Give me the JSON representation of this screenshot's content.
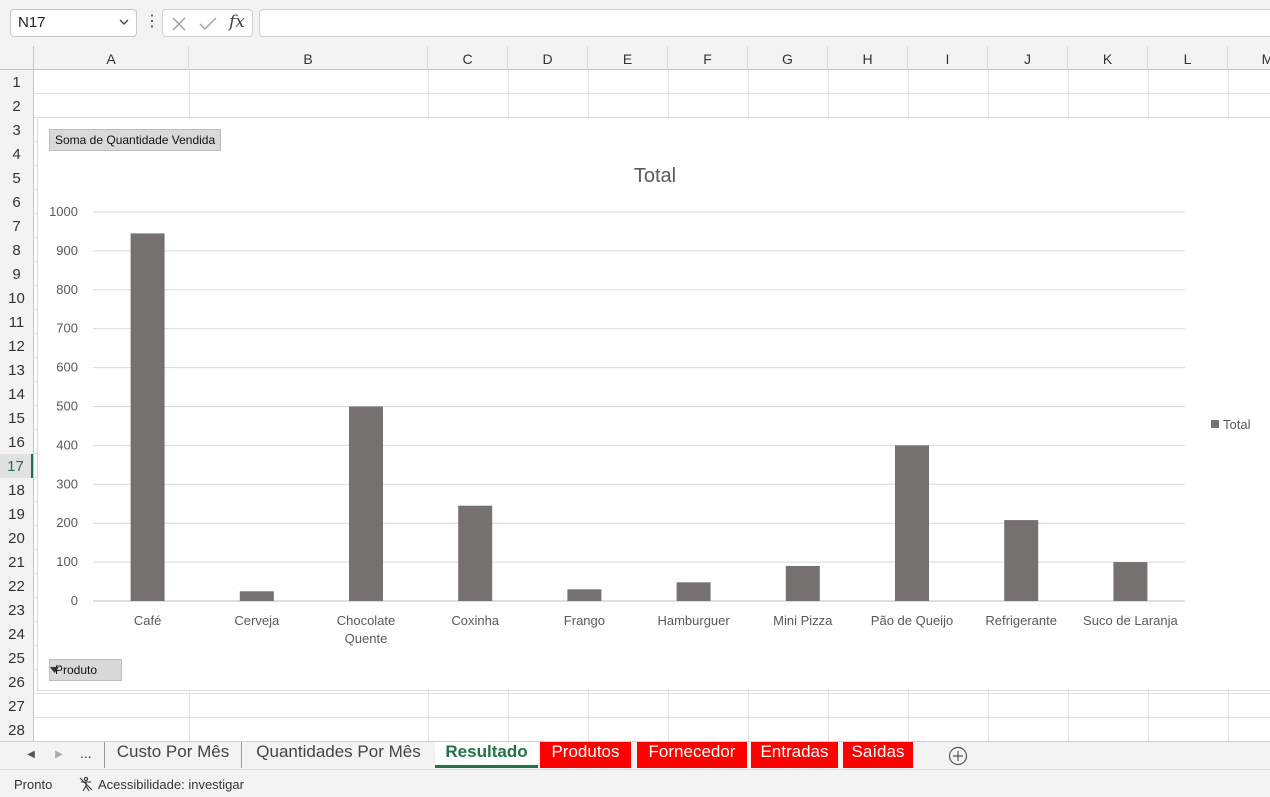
{
  "formula_bar": {
    "name_box": "N17",
    "fx_label": "fx",
    "formula_value": ""
  },
  "columns": [
    "A",
    "B",
    "C",
    "D",
    "E",
    "F",
    "G",
    "H",
    "I",
    "J",
    "K",
    "L",
    "M"
  ],
  "rows": [
    "1",
    "2",
    "3",
    "4",
    "5",
    "6",
    "7",
    "8",
    "9",
    "10",
    "11",
    "12",
    "13",
    "14",
    "15",
    "16",
    "17",
    "18",
    "19",
    "20",
    "21",
    "22",
    "23",
    "24",
    "25",
    "26",
    "27",
    "28"
  ],
  "active_row": "17",
  "pivot_buttons": {
    "values_field": "Soma de Quantidade Vendida",
    "axis_field": "Produto"
  },
  "chart_data": {
    "type": "bar",
    "title": "Total",
    "categories": [
      "Café",
      "Cerveja",
      "Chocolate Quente",
      "Coxinha",
      "Frango",
      "Hamburguer",
      "Mini Pizza",
      "Pão de Queijo",
      "Refrigerante",
      "Suco de Laranja"
    ],
    "category_lines": [
      [
        "Café"
      ],
      [
        "Cerveja"
      ],
      [
        "Chocolate",
        "Quente"
      ],
      [
        "Coxinha"
      ],
      [
        "Frango"
      ],
      [
        "Hamburguer"
      ],
      [
        "Mini Pizza"
      ],
      [
        "Pão de Queijo"
      ],
      [
        "Refrigerante"
      ],
      [
        "Suco de Laranja"
      ]
    ],
    "series": [
      {
        "name": "Total",
        "values": [
          945,
          25,
          500,
          245,
          30,
          48,
          90,
          400,
          208,
          100
        ]
      }
    ],
    "yticks": [
      0,
      100,
      200,
      300,
      400,
      500,
      600,
      700,
      800,
      900,
      1000
    ],
    "ylim": [
      0,
      1000
    ],
    "grid": true,
    "legend": "right",
    "bar_color": "#767171"
  },
  "legend_label": "Total",
  "sheet_tabs": {
    "ellipsis": "...",
    "tabs": [
      "Custo Por Mês",
      "Quantidades Por Mês",
      "Resultado",
      "Produtos",
      "Fornecedor",
      "Entradas",
      "Saídas"
    ],
    "active": "Resultado"
  },
  "status_bar": {
    "ready": "Pronto",
    "accessibility": "Acessibilidade: investigar"
  }
}
